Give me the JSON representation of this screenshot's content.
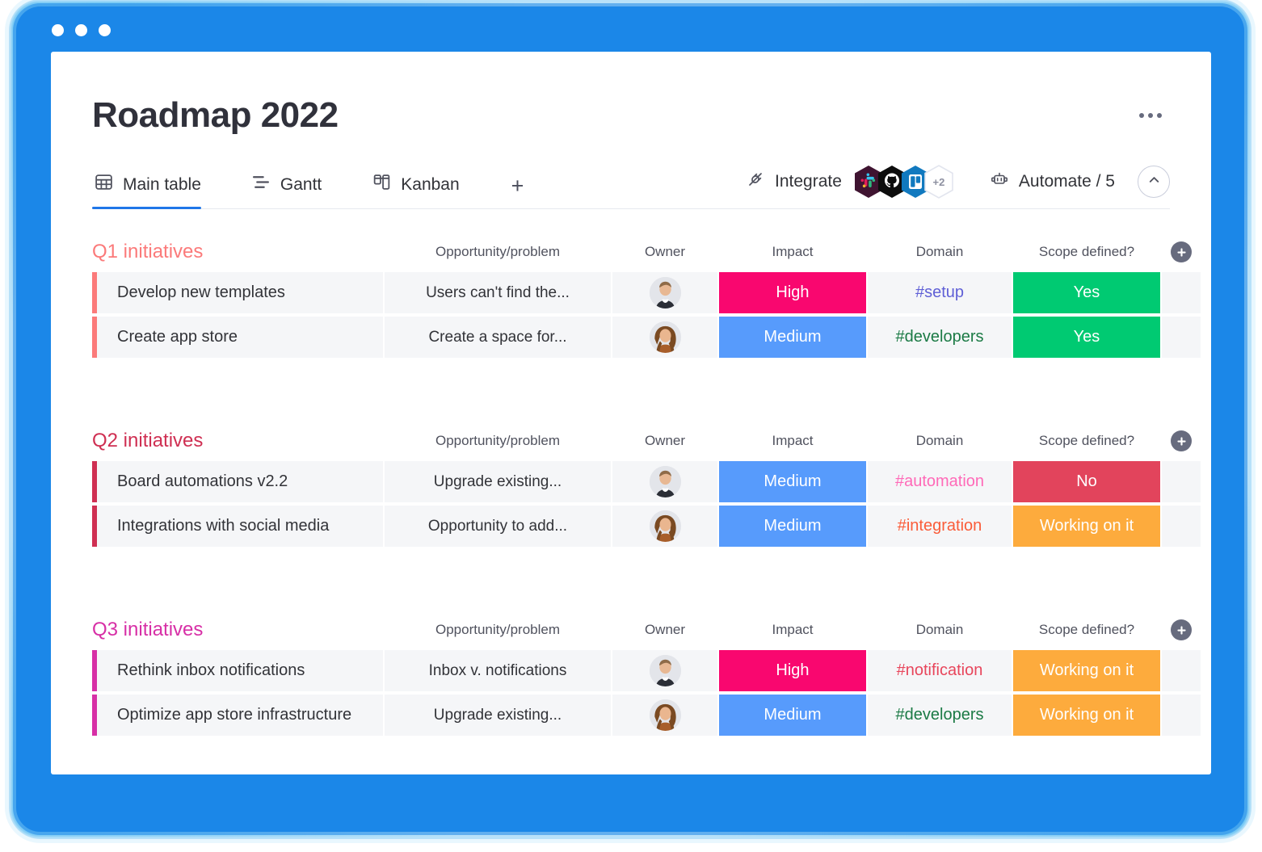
{
  "window": {
    "dots": [
      "close",
      "minimize",
      "maximize"
    ],
    "accent": "#1b87e8"
  },
  "header": {
    "title": "Roadmap 2022",
    "more_label": "…"
  },
  "tabs": [
    {
      "id": "main-table",
      "label": "Main table",
      "icon": "table-grid-icon",
      "active": true
    },
    {
      "id": "gantt",
      "label": "Gantt",
      "icon": "gantt-bars-icon",
      "active": false
    },
    {
      "id": "kanban",
      "label": "Kanban",
      "icon": "kanban-columns-icon",
      "active": false
    }
  ],
  "tab_add_label": "+",
  "toolbar": {
    "integrate_label": "Integrate",
    "integrate_icon": "plug-icon",
    "integrations": [
      {
        "name": "slack",
        "color": "#3f1431"
      },
      {
        "name": "github",
        "color": "#000000"
      },
      {
        "name": "trello",
        "color": "#1179bf"
      }
    ],
    "integrations_overflow": "+2",
    "automate_label": "Automate / 5",
    "automate_icon": "robot-icon",
    "collapse_icon": "chevron-up-icon"
  },
  "columns": [
    "",
    "Opportunity/problem",
    "Owner",
    "Impact",
    "Domain",
    "Scope defined?"
  ],
  "add_column_label": "+",
  "groups": [
    {
      "title": "Q1 initiatives",
      "color": "#fb7a7a",
      "rows": [
        {
          "name": "Develop new templates",
          "opportunity": "Users can't find the...",
          "owner": "male-avatar",
          "impact": "High",
          "impact_color": "#f9076f",
          "domain": "#setup",
          "domain_color": "#5f5fd6",
          "scope": "Yes",
          "scope_color": "#00ca72"
        },
        {
          "name": "Create app store",
          "opportunity": "Create a space for...",
          "owner": "female-avatar",
          "impact": "Medium",
          "impact_color": "#579bfc",
          "domain": "#developers",
          "domain_color": "#1b7a45",
          "scope": "Yes",
          "scope_color": "#00ca72"
        }
      ]
    },
    {
      "title": "Q2 initiatives",
      "color": "#cf2f52",
      "rows": [
        {
          "name": "Board automations v2.2",
          "opportunity": "Upgrade existing...",
          "owner": "male-avatar",
          "impact": "Medium",
          "impact_color": "#579bfc",
          "domain": "#automation",
          "domain_color": "#ff6ab8",
          "scope": "No",
          "scope_color": "#e2445c"
        },
        {
          "name": "Integrations with social media",
          "opportunity": "Opportunity to add...",
          "owner": "female-avatar",
          "impact": "Medium",
          "impact_color": "#579bfc",
          "domain": "#integration",
          "domain_color": "#fa5c39",
          "scope": "Working on it",
          "scope_color": "#fdab3d"
        }
      ]
    },
    {
      "title": "Q3 initiatives",
      "color": "#d72fa6",
      "rows": [
        {
          "name": "Rethink inbox notifications",
          "opportunity": "Inbox v. notifications",
          "owner": "male-avatar",
          "impact": "High",
          "impact_color": "#f9076f",
          "domain": "#notification",
          "domain_color": "#e8465c",
          "scope": "Working on it",
          "scope_color": "#fdab3d"
        },
        {
          "name": "Optimize app store infrastructure",
          "opportunity": "Upgrade existing...",
          "owner": "female-avatar",
          "impact": "Medium",
          "impact_color": "#579bfc",
          "domain": "#developers",
          "domain_color": "#1b7a45",
          "scope": "Working on it",
          "scope_color": "#fdab3d"
        }
      ]
    }
  ]
}
